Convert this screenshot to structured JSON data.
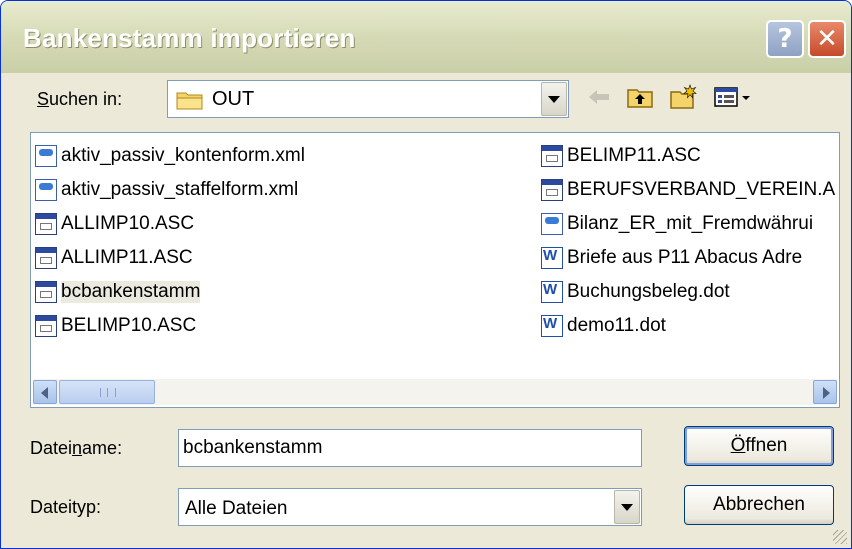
{
  "window": {
    "title": "Bankenstamm importieren",
    "help_glyph": "?",
    "close_glyph": "✕"
  },
  "lookin": {
    "label_prefix": "S",
    "label_rest": "uchen in:",
    "value": "OUT"
  },
  "toolbar": {
    "back_icon": "back-arrow-icon",
    "up_icon": "up-one-level-icon",
    "newfolder_icon": "new-folder-icon",
    "view_icon": "view-menu-icon"
  },
  "files": {
    "col1": [
      {
        "name": "aktiv_passiv_kontenform.xml",
        "icon": "xml-file-icon"
      },
      {
        "name": "aktiv_passiv_staffelform.xml",
        "icon": "xml-file-icon"
      },
      {
        "name": "ALLIMP10.ASC",
        "icon": "asc-file-icon"
      },
      {
        "name": "ALLIMP11.ASC",
        "icon": "asc-file-icon"
      },
      {
        "name": "bcbankenstamm",
        "icon": "asc-file-icon",
        "selected": true
      },
      {
        "name": "BELIMP10.ASC",
        "icon": "asc-file-icon"
      }
    ],
    "col2": [
      {
        "name": "BELIMP11.ASC",
        "icon": "asc-file-icon"
      },
      {
        "name": "BERUFSVERBAND_VEREIN.A",
        "icon": "asc-file-icon"
      },
      {
        "name": "Bilanz_ER_mit_Fremdwährui",
        "icon": "xml-file-icon"
      },
      {
        "name": "Briefe aus P11 Abacus Adre",
        "icon": "word-doc-icon"
      },
      {
        "name": "Buchungsbeleg.dot",
        "icon": "word-doc-icon"
      },
      {
        "name": "demo11.dot",
        "icon": "word-doc-icon"
      }
    ]
  },
  "scrollbar": {
    "grip": "III"
  },
  "filename": {
    "label_a": "Datei",
    "label_u": "n",
    "label_b": "ame:",
    "value": "bcbankenstamm"
  },
  "filetype": {
    "label": "Dateityp:",
    "value": "Alle Dateien"
  },
  "buttons": {
    "open_u": "Ö",
    "open_rest": "ffnen",
    "cancel": "Abbrechen"
  },
  "colors": {
    "selection": "#ebeadf",
    "frame": "#ece9d8",
    "accent": "#0831d9"
  }
}
